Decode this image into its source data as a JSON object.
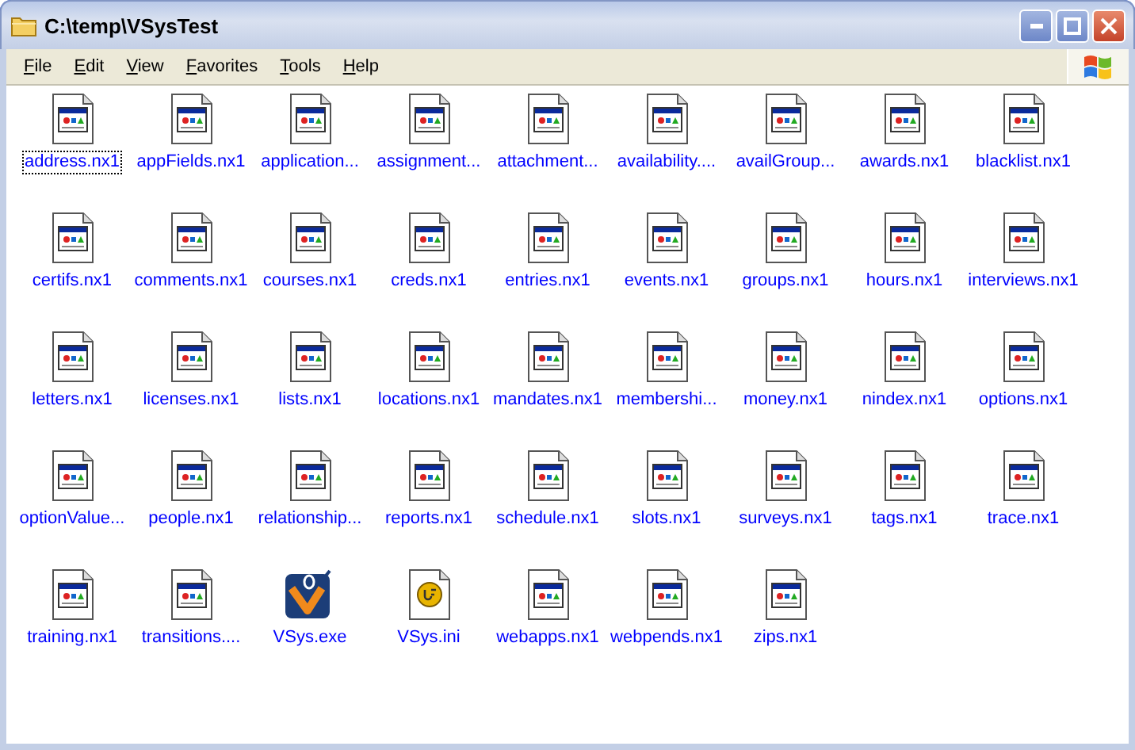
{
  "window": {
    "title": "C:\\temp\\VSysTest"
  },
  "menu": [
    "File",
    "Edit",
    "View",
    "Favorites",
    "Tools",
    "Help"
  ],
  "files": [
    {
      "name": "address.nx1",
      "kind": "nx1",
      "selected": true
    },
    {
      "name": "appFields.nx1",
      "kind": "nx1",
      "selected": false
    },
    {
      "name": "application...",
      "kind": "nx1",
      "selected": false
    },
    {
      "name": "assignment...",
      "kind": "nx1",
      "selected": false
    },
    {
      "name": "attachment...",
      "kind": "nx1",
      "selected": false
    },
    {
      "name": "availability....",
      "kind": "nx1",
      "selected": false
    },
    {
      "name": "availGroup...",
      "kind": "nx1",
      "selected": false
    },
    {
      "name": "awards.nx1",
      "kind": "nx1",
      "selected": false
    },
    {
      "name": "blacklist.nx1",
      "kind": "nx1",
      "selected": false
    },
    {
      "name": "certifs.nx1",
      "kind": "nx1",
      "selected": false
    },
    {
      "name": "comments.nx1",
      "kind": "nx1",
      "selected": false
    },
    {
      "name": "courses.nx1",
      "kind": "nx1",
      "selected": false
    },
    {
      "name": "creds.nx1",
      "kind": "nx1",
      "selected": false
    },
    {
      "name": "entries.nx1",
      "kind": "nx1",
      "selected": false
    },
    {
      "name": "events.nx1",
      "kind": "nx1",
      "selected": false
    },
    {
      "name": "groups.nx1",
      "kind": "nx1",
      "selected": false
    },
    {
      "name": "hours.nx1",
      "kind": "nx1",
      "selected": false
    },
    {
      "name": "interviews.nx1",
      "kind": "nx1",
      "selected": false
    },
    {
      "name": "letters.nx1",
      "kind": "nx1",
      "selected": false
    },
    {
      "name": "licenses.nx1",
      "kind": "nx1",
      "selected": false
    },
    {
      "name": "lists.nx1",
      "kind": "nx1",
      "selected": false
    },
    {
      "name": "locations.nx1",
      "kind": "nx1",
      "selected": false
    },
    {
      "name": "mandates.nx1",
      "kind": "nx1",
      "selected": false
    },
    {
      "name": "membershi...",
      "kind": "nx1",
      "selected": false
    },
    {
      "name": "money.nx1",
      "kind": "nx1",
      "selected": false
    },
    {
      "name": "nindex.nx1",
      "kind": "nx1",
      "selected": false
    },
    {
      "name": "options.nx1",
      "kind": "nx1",
      "selected": false
    },
    {
      "name": "optionValue...",
      "kind": "nx1",
      "selected": false
    },
    {
      "name": "people.nx1",
      "kind": "nx1",
      "selected": false
    },
    {
      "name": "relationship...",
      "kind": "nx1",
      "selected": false
    },
    {
      "name": "reports.nx1",
      "kind": "nx1",
      "selected": false
    },
    {
      "name": "schedule.nx1",
      "kind": "nx1",
      "selected": false
    },
    {
      "name": "slots.nx1",
      "kind": "nx1",
      "selected": false
    },
    {
      "name": "surveys.nx1",
      "kind": "nx1",
      "selected": false
    },
    {
      "name": "tags.nx1",
      "kind": "nx1",
      "selected": false
    },
    {
      "name": "trace.nx1",
      "kind": "nx1",
      "selected": false
    },
    {
      "name": "training.nx1",
      "kind": "nx1",
      "selected": false
    },
    {
      "name": "transitions....",
      "kind": "nx1",
      "selected": false
    },
    {
      "name": "VSys.exe",
      "kind": "exe",
      "selected": false
    },
    {
      "name": "VSys.ini",
      "kind": "ini",
      "selected": false
    },
    {
      "name": "webapps.nx1",
      "kind": "nx1",
      "selected": false
    },
    {
      "name": "webpends.nx1",
      "kind": "nx1",
      "selected": false
    },
    {
      "name": "zips.nx1",
      "kind": "nx1",
      "selected": false
    }
  ]
}
